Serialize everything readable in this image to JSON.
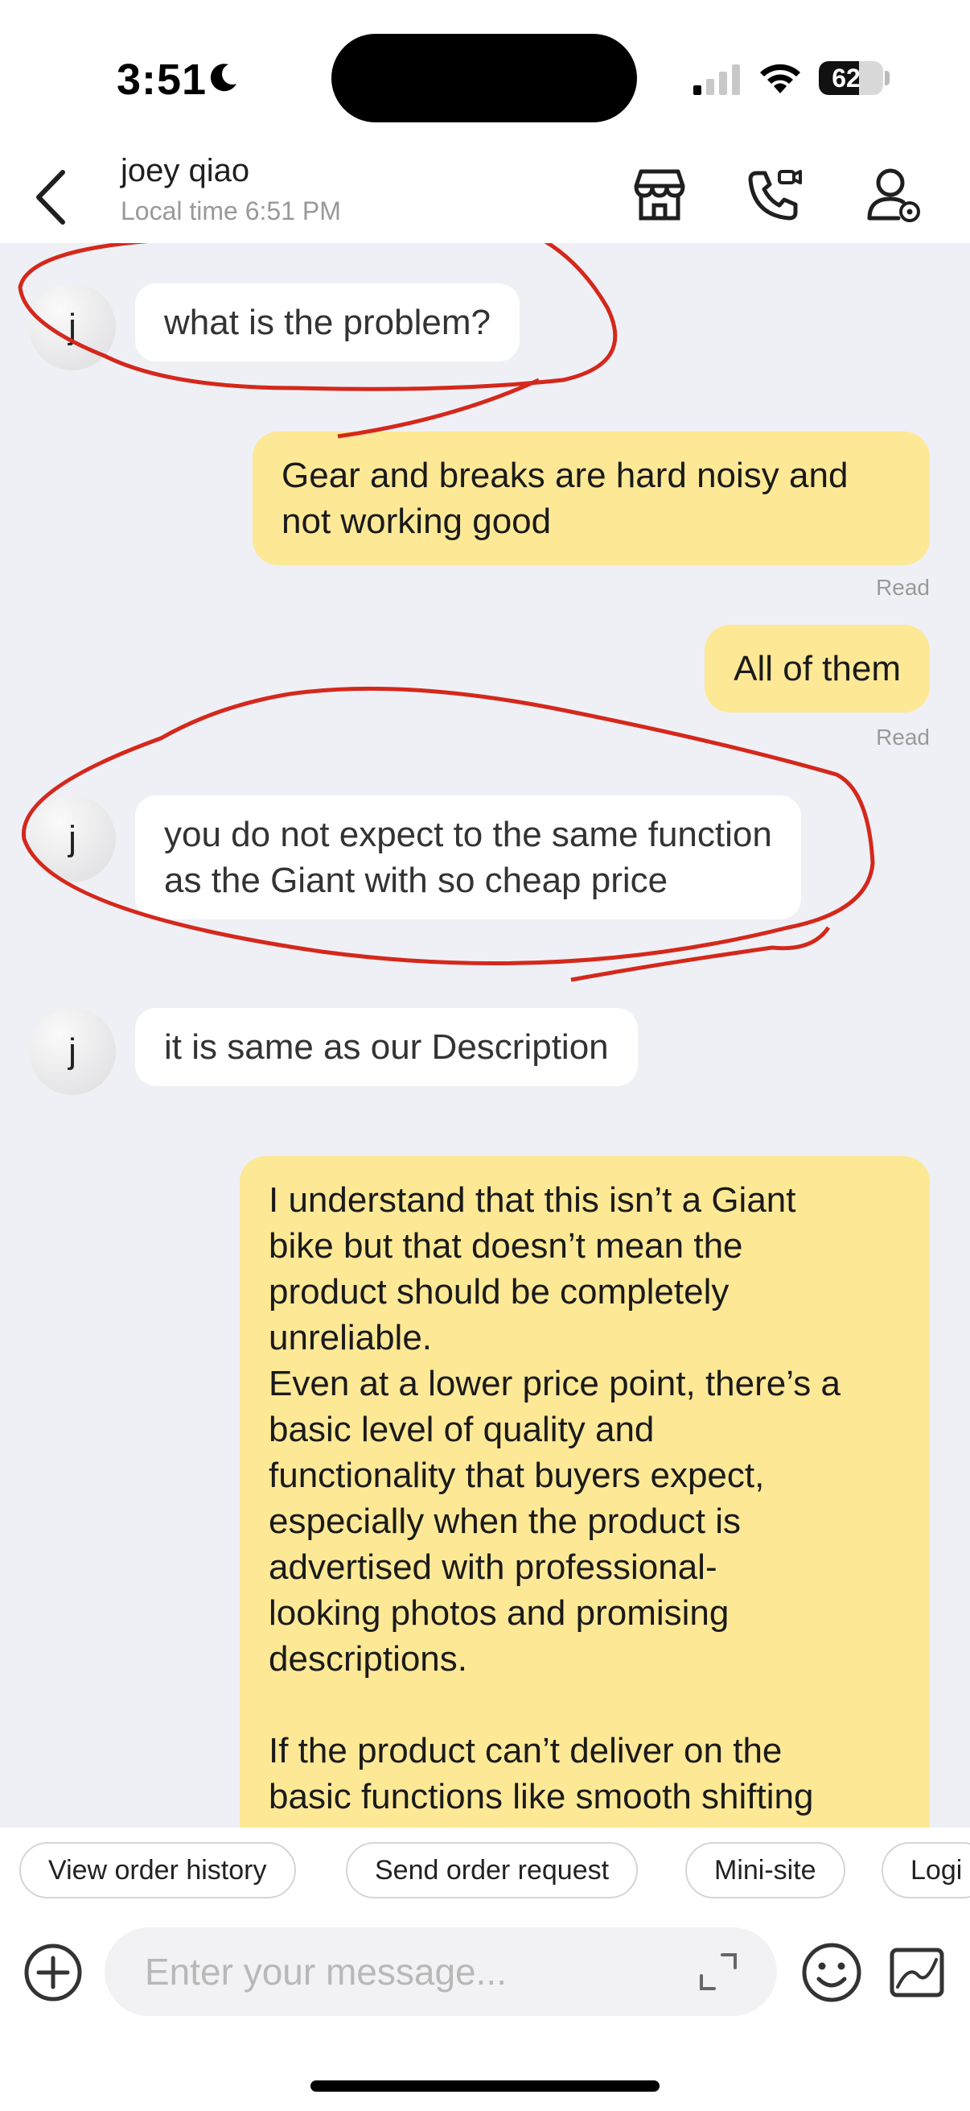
{
  "status_bar": {
    "time": "3:51",
    "battery": "62",
    "battery_level": 0.62
  },
  "header": {
    "contact_name": "joey qiao",
    "local_time": "Local time 6:51 PM",
    "icons": [
      "back-icon",
      "store-icon",
      "call-icon",
      "contact-profile-icon"
    ]
  },
  "messages": [
    {
      "from": "seller",
      "avatar": "j",
      "text": "what is the problem?"
    },
    {
      "from": "me",
      "text": "Gear and breaks are hard noisy and\nnot working good",
      "status": "Read"
    },
    {
      "from": "me",
      "text": "All of them",
      "status": "Read"
    },
    {
      "from": "seller",
      "avatar": "j",
      "text": "you do not expect to the same function\nas the Giant with so cheap price"
    },
    {
      "from": "seller",
      "avatar": "j",
      "text": "it is same as our Description"
    },
    {
      "from": "me",
      "text": "I understand that this isn’t a Giant\nbike but that doesn’t mean the\nproduct should be completely\nunreliable.\nEven at a lower price point, there’s a\nbasic level of quality and\nfunctionality that buyers expect,\nespecially when the product is\nadvertised with professional-\nlooking photos and promising\ndescriptions.\n\nIf the product can’t deliver on the\nbasic functions like smooth shifting\nand reliable braking, then it does not"
    }
  ],
  "quick_replies": [
    "View order history",
    "Send order request",
    "Mini-site",
    "Logi"
  ],
  "input": {
    "placeholder": "Enter your message..."
  },
  "colors": {
    "outgoing_bubble": "#fde896",
    "incoming_bubble": "#ffffff",
    "chat_background": "#eff0f5",
    "annotation_red": "#d4281c"
  }
}
